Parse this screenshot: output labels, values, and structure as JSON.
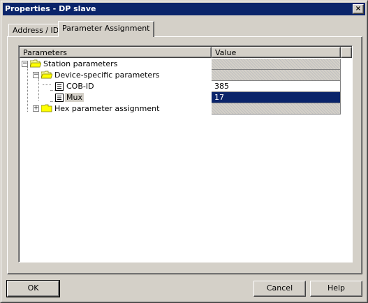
{
  "window": {
    "title": "Properties - DP slave",
    "close_symbol": "×"
  },
  "tabs": [
    {
      "label": "Address / ID",
      "active": false
    },
    {
      "label": "Parameter Assignment",
      "active": true
    }
  ],
  "grid": {
    "columns": [
      "Parameters",
      "Value"
    ],
    "rows": [
      {
        "label": "Station parameters",
        "icon": "folder-open-icon",
        "expander": "−",
        "value": ""
      },
      {
        "label": "Device-specific parameters",
        "icon": "folder-open-icon",
        "expander": "−",
        "value": ""
      },
      {
        "label": "COB-ID",
        "icon": "parameter-doc-icon",
        "value": "385"
      },
      {
        "label": "Mux",
        "icon": "parameter-doc-icon",
        "value": "17",
        "selected": true
      },
      {
        "label": "Hex parameter assignment",
        "icon": "folder-closed-icon",
        "expander": "+",
        "value": ""
      }
    ]
  },
  "buttons": {
    "ok": "OK",
    "cancel": "Cancel",
    "help": "Help"
  },
  "colors": {
    "title_bar": "#0a246a",
    "selection": "#0a246a",
    "face": "#d4d0c8"
  }
}
